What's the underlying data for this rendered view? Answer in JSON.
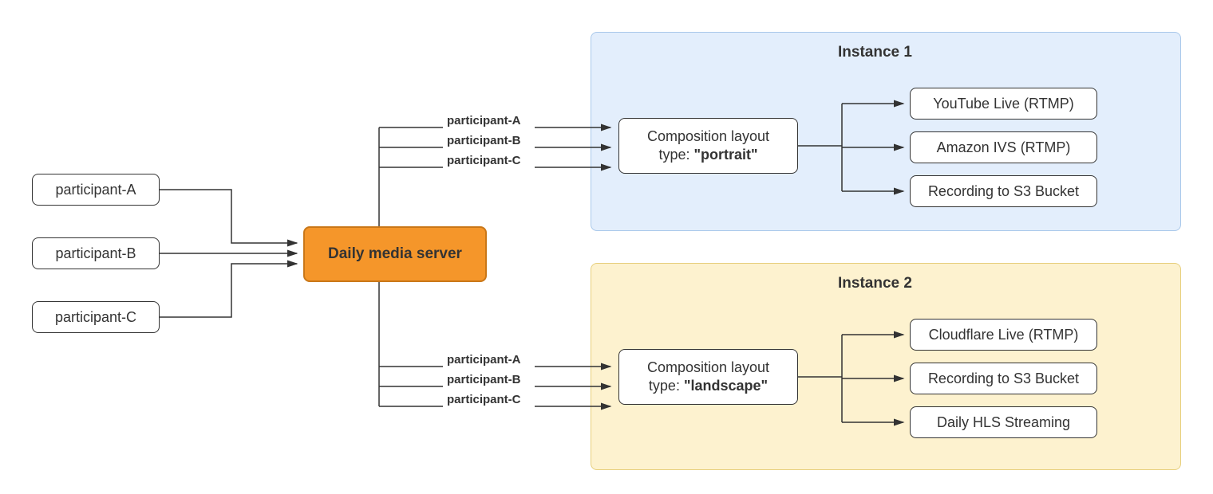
{
  "participants": [
    "participant-A",
    "participant-B",
    "participant-C"
  ],
  "server": {
    "label": "Daily media server"
  },
  "instance1": {
    "title": "Instance 1",
    "edge_labels": [
      "participant-A",
      "participant-B",
      "participant-C"
    ],
    "composition": {
      "line1": "Composition layout",
      "line2_prefix": "type: ",
      "line2_bold": "\"portrait\""
    },
    "outputs": [
      "YouTube Live (RTMP)",
      "Amazon IVS (RTMP)",
      "Recording to S3 Bucket"
    ]
  },
  "instance2": {
    "title": "Instance 2",
    "edge_labels": [
      "participant-A",
      "participant-B",
      "participant-C"
    ],
    "composition": {
      "line1": "Composition layout",
      "line2_prefix": "type: ",
      "line2_bold": "\"landscape\""
    },
    "outputs": [
      "Cloudflare Live (RTMP)",
      "Recording to S3 Bucket",
      "Daily HLS Streaming"
    ]
  }
}
